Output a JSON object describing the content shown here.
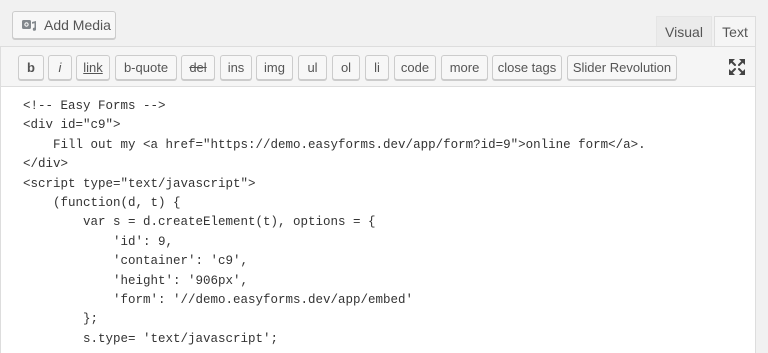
{
  "media": {
    "add_media_label": "Add Media",
    "icon": "camera-music-icon"
  },
  "tabs": {
    "visual": "Visual",
    "text": "Text",
    "active": "Text"
  },
  "toolbar": {
    "buttons": [
      {
        "label": "b"
      },
      {
        "label": "i"
      },
      {
        "label": "link"
      },
      {
        "label": "b-quote"
      },
      {
        "label": "del"
      },
      {
        "label": "ins"
      },
      {
        "label": "img"
      },
      {
        "label": "ul"
      },
      {
        "label": "ol"
      },
      {
        "label": "li"
      },
      {
        "label": "code"
      },
      {
        "label": "more"
      },
      {
        "label": "close tags"
      },
      {
        "label": "Slider Revolution"
      }
    ],
    "fullscreen_icon": "fullscreen-expand-icon"
  },
  "code": {
    "lines": [
      "<!-- Easy Forms -->",
      "<div id=\"c9\">",
      "    Fill out my <a href=\"https://demo.easyforms.dev/app/form?id=9\">online form</a>.",
      "</div>",
      "<script type=\"text/javascript\">",
      "    (function(d, t) {",
      "        var s = d.createElement(t), options = {",
      "            'id': 9,",
      "            'container': 'c9',",
      "            'height': '906px',",
      "            'form': '//demo.easyforms.dev/app/embed'",
      "        };",
      "        s.type= 'text/javascript';"
    ]
  }
}
